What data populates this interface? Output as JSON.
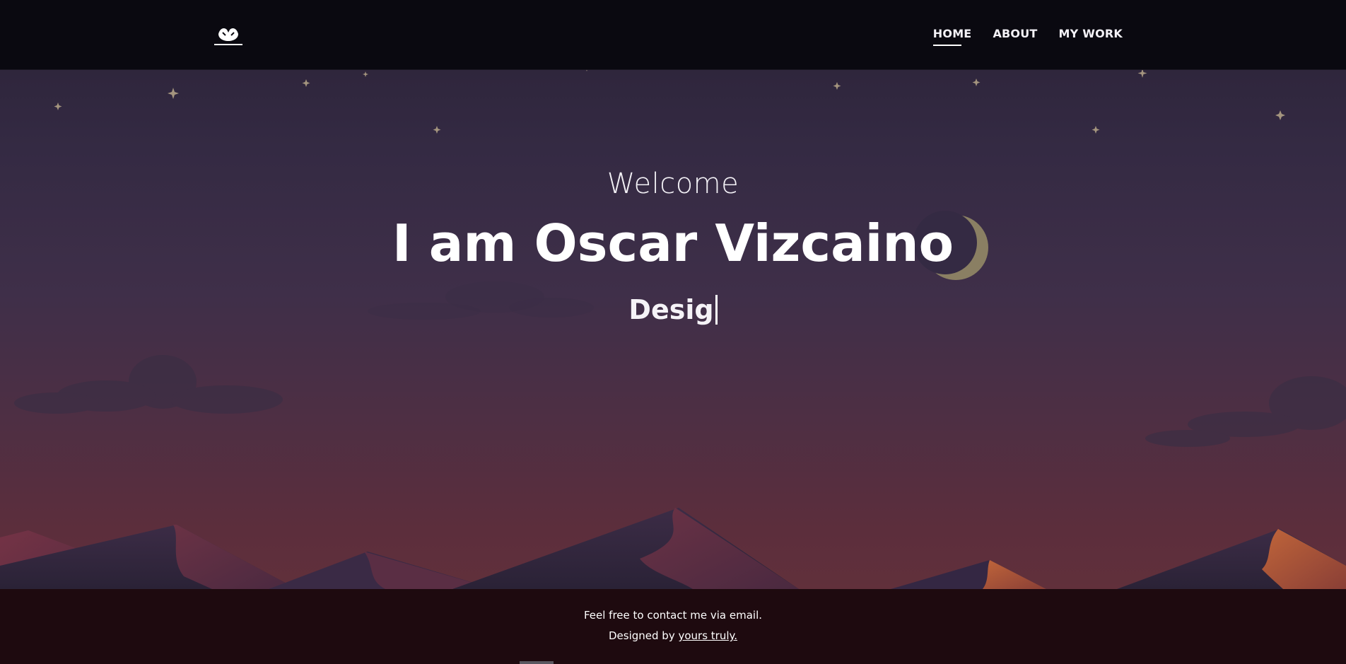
{
  "navbar": {
    "logo_icon": "hands-logo-icon",
    "links": [
      {
        "label": "HOME",
        "active": true
      },
      {
        "label": "ABOUT",
        "active": false
      },
      {
        "label": "MY WORK",
        "active": false
      }
    ]
  },
  "hero": {
    "welcome": "Welcome",
    "name": "I am Oscar Vizcaino",
    "typed_text": "Desig"
  },
  "footer": {
    "line1": "Feel free to contact me via email.",
    "line2_prefix": "Designed by ",
    "line2_link": "yours truly."
  },
  "colors": {
    "nav_background": "#0a0910",
    "sky_top": "#2a2236",
    "sky_bottom": "#61303b",
    "footer_background": "#1e0a0f",
    "moon": "#8a7f63",
    "dune_dark": "#2a2338",
    "dune_orange": "#b25a35"
  }
}
